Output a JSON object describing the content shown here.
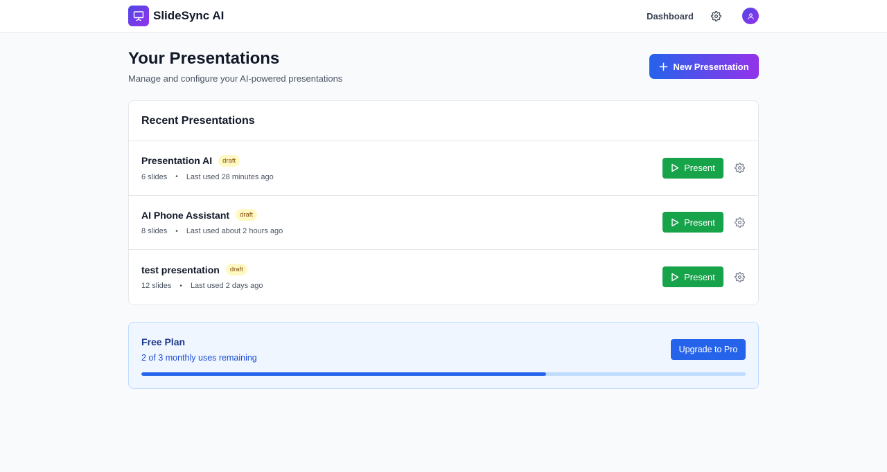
{
  "app": {
    "name": "SlideSync AI",
    "logo_icon": "presentation-screen-icon",
    "accent_gradient": [
      "#4f46e5",
      "#9333ea"
    ]
  },
  "nav": {
    "dashboard_label": "Dashboard",
    "settings_icon": "gear-icon",
    "avatar_icon": "user-icon"
  },
  "page": {
    "title": "Your Presentations",
    "subtitle": "Manage and configure your AI-powered presentations",
    "new_button_label": "New Presentation"
  },
  "recent": {
    "title": "Recent Presentations",
    "items": [
      {
        "name": "Presentation AI",
        "status": "draft",
        "slides": "6 slides",
        "last_used": "Last used 28 minutes ago",
        "present_label": "Present"
      },
      {
        "name": "AI Phone Assistant",
        "status": "draft",
        "slides": "8 slides",
        "last_used": "Last used about 2 hours ago",
        "present_label": "Present"
      },
      {
        "name": "test presentation",
        "status": "draft",
        "slides": "12 slides",
        "last_used": "Last used 2 days ago",
        "present_label": "Present"
      }
    ]
  },
  "plan": {
    "title": "Free Plan",
    "usage_text": "2 of 3 monthly uses remaining",
    "upgrade_label": "Upgrade to Pro",
    "progress_fraction": 0.67,
    "colors": {
      "fill": "#2563eb",
      "track": "#bfdbfe"
    }
  },
  "colors": {
    "present_button": "#16a34a",
    "draft_badge_bg": "#fef9c3"
  }
}
